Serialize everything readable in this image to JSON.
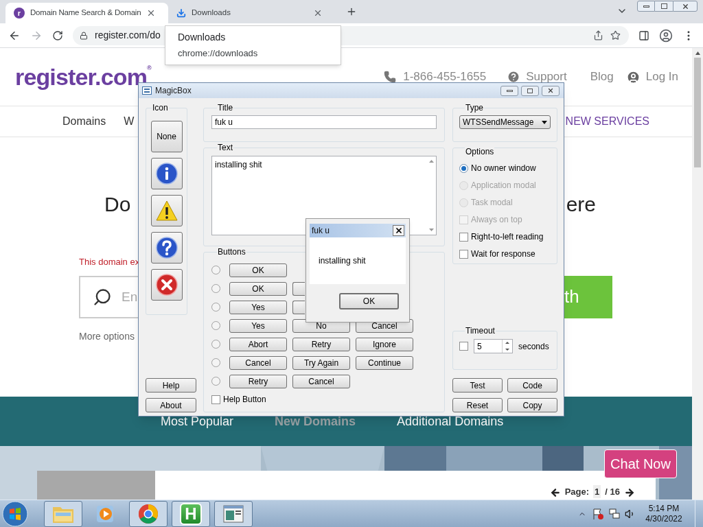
{
  "browser": {
    "tabs": [
      {
        "kind": "site",
        "favicon": "r",
        "title": "Domain Name Search & Domain",
        "selected": true
      },
      {
        "kind": "download",
        "title": "Downloads",
        "selected": false
      }
    ],
    "tooltip": {
      "title": "Downloads",
      "url": "chrome://downloads"
    },
    "address": "register.com/do"
  },
  "page": {
    "logo": "register.com",
    "logo_mark": "®",
    "phone": "1-866-455-1655",
    "support": "Support",
    "blog": "Blog",
    "login": "Log In",
    "nav": [
      {
        "label": "Domains",
        "kind": "plain"
      },
      {
        "label": "W",
        "kind": "plain"
      },
      {
        "label": "NEW SERVICES",
        "kind": "highlight"
      }
    ],
    "heading": [
      "Do",
      "ere"
    ],
    "notice": "This domain ex",
    "search_placeholder": "En",
    "search_button": "th",
    "more_options": "More options",
    "tabs": [
      {
        "label": "Most Popular",
        "selected": false
      },
      {
        "label": "New Domains",
        "selected": true
      },
      {
        "label": "Additional Domains",
        "selected": false
      }
    ],
    "chat": "Chat Now",
    "pager": {
      "label": "Page:",
      "current": "1",
      "total": "/ 16"
    }
  },
  "magicbox": {
    "title": "MagicBox",
    "icon_group": {
      "label": "Icon",
      "icons": [
        {
          "kind": "none",
          "label": "None"
        },
        {
          "kind": "info"
        },
        {
          "kind": "warning"
        },
        {
          "kind": "question"
        },
        {
          "kind": "error"
        }
      ]
    },
    "title_group": {
      "label": "Title",
      "value": "fuk u"
    },
    "text_group": {
      "label": "Text",
      "value": "installing shit"
    },
    "buttons_group": {
      "label": "Buttons",
      "rows": [
        {
          "selected": false,
          "buttons": [
            {
              "kind": "label",
              "label": "OK"
            }
          ]
        },
        {
          "selected": false,
          "buttons": [
            {
              "kind": "label",
              "label": "OK"
            },
            {
              "kind": "covered"
            }
          ]
        },
        {
          "selected": false,
          "buttons": [
            {
              "kind": "label",
              "label": "Yes"
            },
            {
              "kind": "covered"
            }
          ]
        },
        {
          "selected": false,
          "buttons": [
            {
              "kind": "label",
              "label": "Yes"
            },
            {
              "kind": "label",
              "label": "No"
            },
            {
              "kind": "label",
              "label": "Cancel"
            }
          ]
        },
        {
          "selected": false,
          "buttons": [
            {
              "kind": "label",
              "label": "Abort"
            },
            {
              "kind": "label",
              "label": "Retry"
            },
            {
              "kind": "label",
              "label": "Ignore"
            }
          ]
        },
        {
          "selected": false,
          "buttons": [
            {
              "kind": "label",
              "label": "Cancel"
            },
            {
              "kind": "label",
              "label": "Try Again"
            },
            {
              "kind": "label",
              "label": "Continue"
            }
          ]
        },
        {
          "selected": false,
          "buttons": [
            {
              "kind": "label",
              "label": "Retry"
            },
            {
              "kind": "label",
              "label": "Cancel"
            }
          ]
        }
      ],
      "help_button": {
        "label": "Help Button",
        "checked": false
      }
    },
    "type_group": {
      "label": "Type",
      "value": "WTSSendMessage"
    },
    "options": {
      "label": "Options",
      "items": [
        {
          "kind": "radio",
          "label": "No owner window",
          "selected": true,
          "disabled": false
        },
        {
          "kind": "radio",
          "label": "Application modal",
          "selected": false,
          "disabled": true
        },
        {
          "kind": "radio",
          "label": "Task modal",
          "selected": false,
          "disabled": true
        },
        {
          "kind": "checkbox",
          "label": "Always on top",
          "checked": false,
          "disabled": true
        },
        {
          "kind": "checkbox",
          "label": "Right-to-left reading",
          "checked": false,
          "disabled": false
        },
        {
          "kind": "checkbox",
          "label": "Wait for response",
          "checked": false,
          "disabled": false
        }
      ]
    },
    "timeout": {
      "label": "Timeout",
      "checked": false,
      "value": "5",
      "unit": "seconds"
    },
    "left_buttons": [
      "Help",
      "About"
    ],
    "right_buttons": [
      "Test",
      "Code",
      "Reset",
      "Copy"
    ]
  },
  "message_box": {
    "title": "fuk u",
    "text": "installing shit",
    "button": "OK"
  },
  "taskbar": {
    "apps": [
      {
        "kind": "explorer",
        "running": true
      },
      {
        "kind": "media",
        "running": false
      },
      {
        "kind": "chrome",
        "running": true
      },
      {
        "kind": "letter",
        "label": "H",
        "running": true
      },
      {
        "kind": "window",
        "running": true
      }
    ],
    "time": "5:14 PM",
    "date": "4/30/2022"
  }
}
